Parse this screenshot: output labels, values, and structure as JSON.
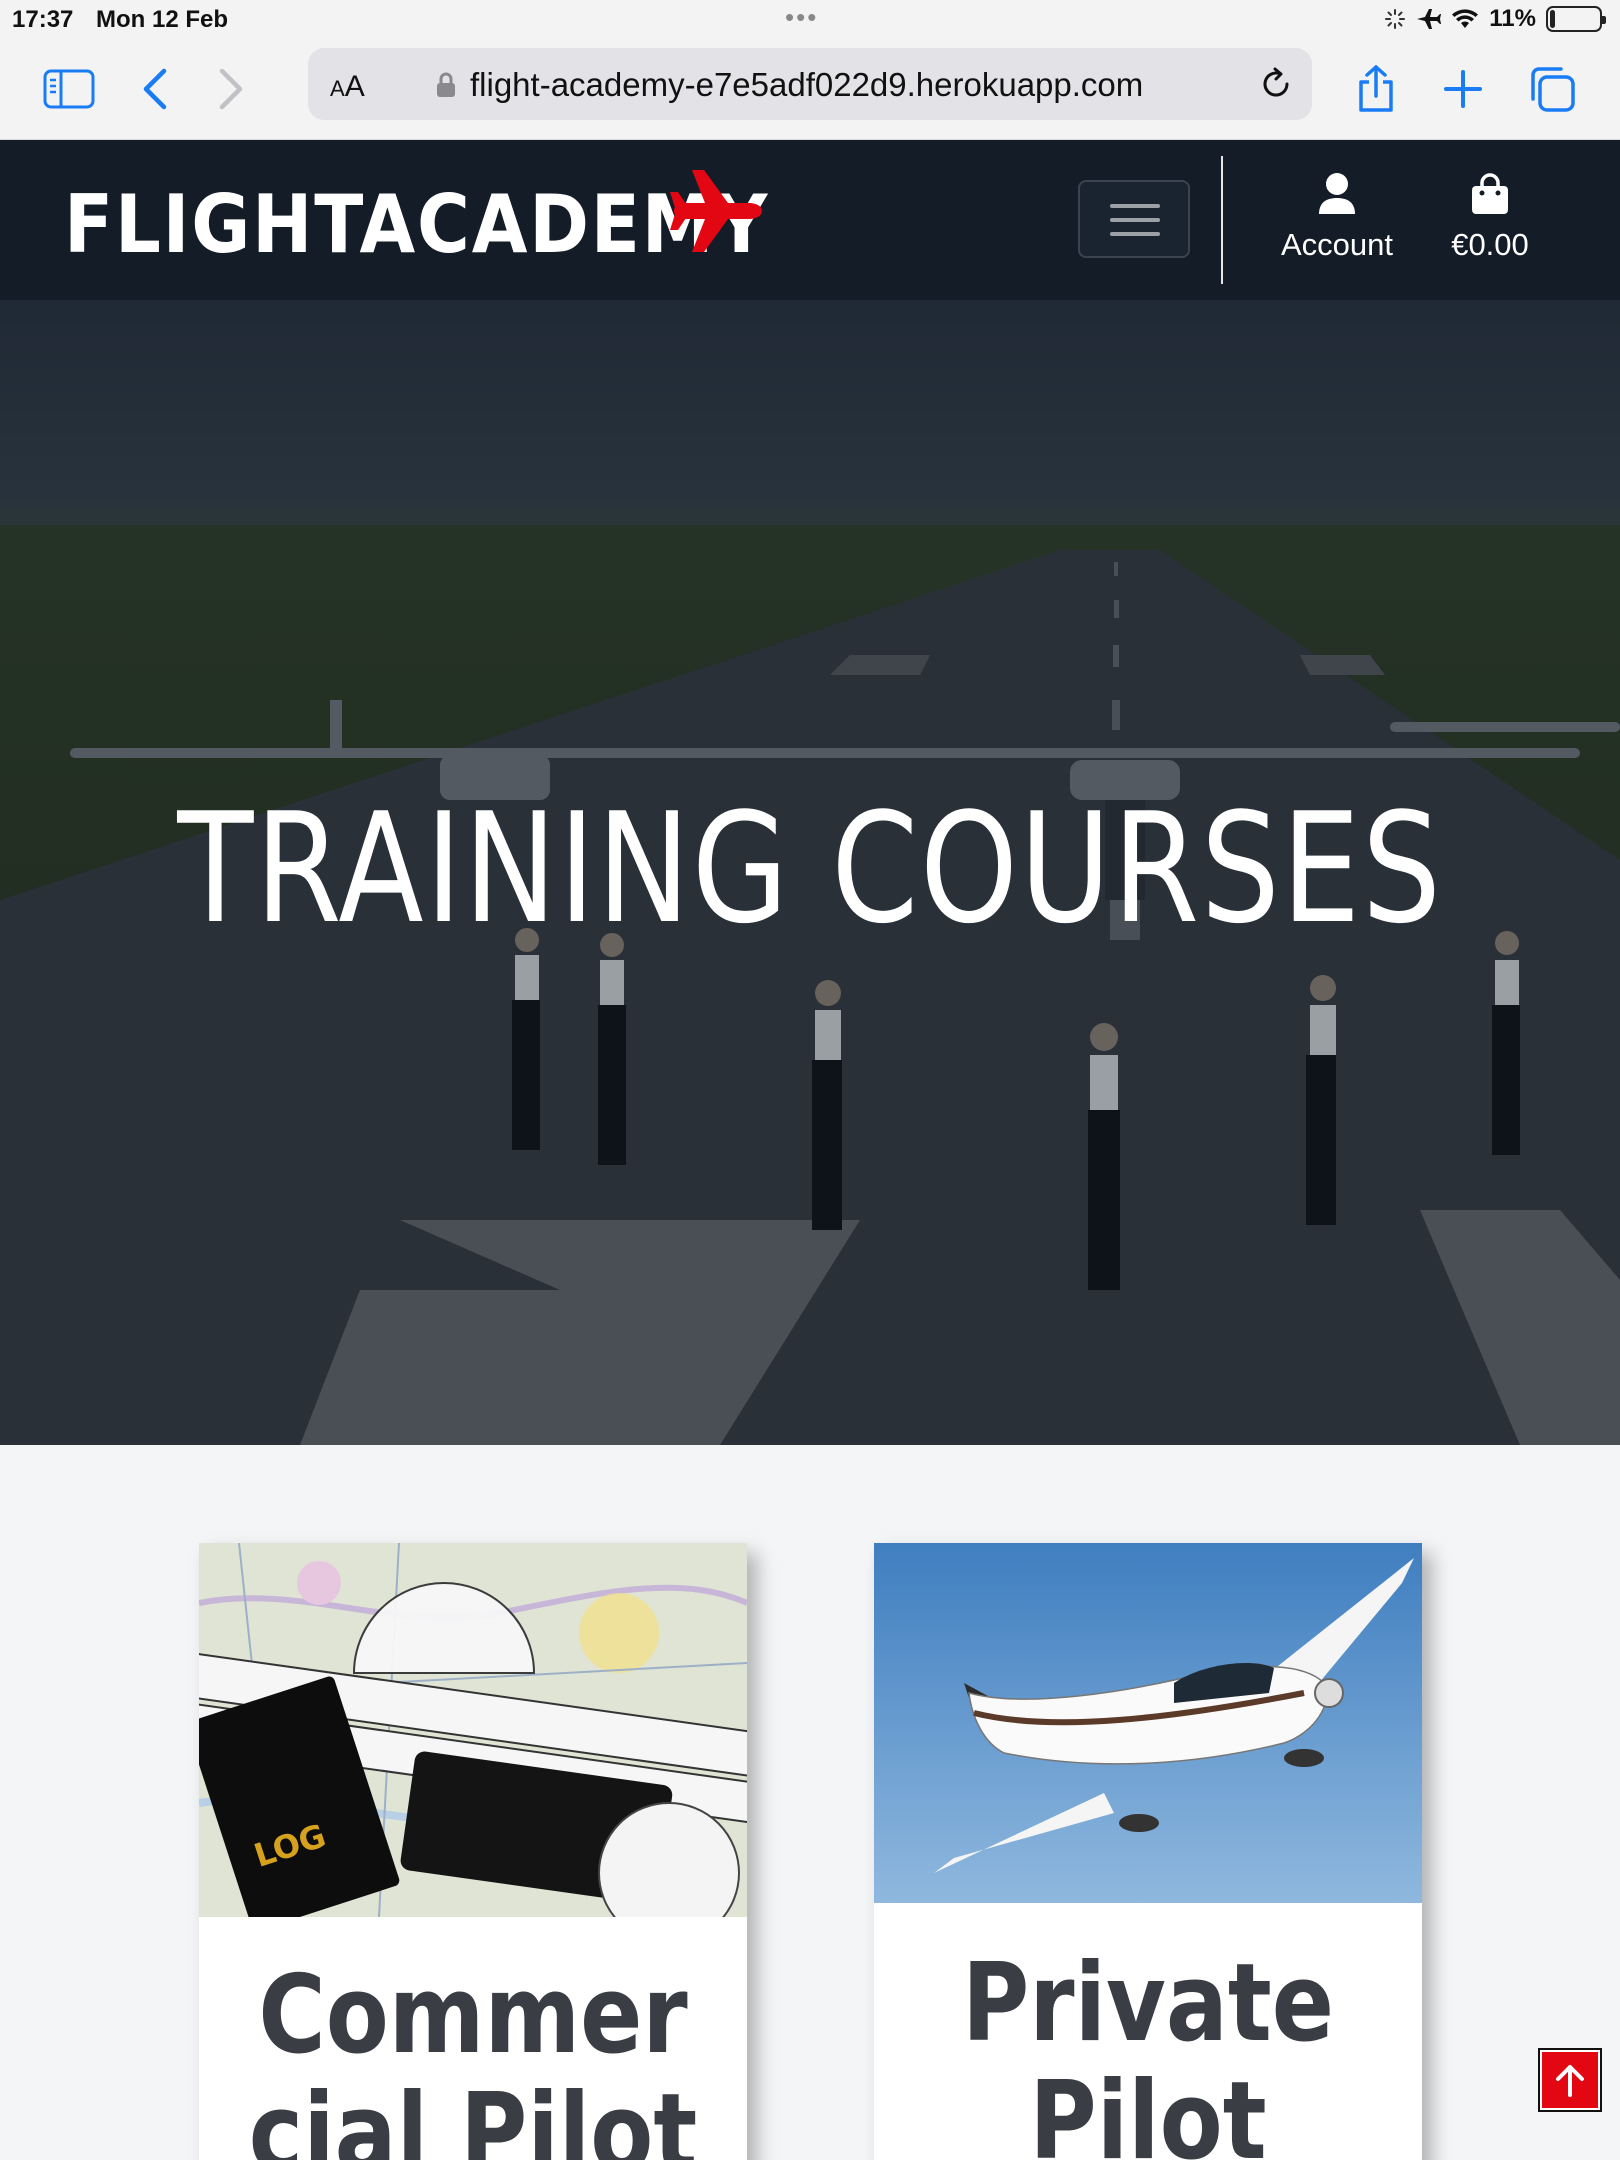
{
  "status_bar": {
    "time": "17:37",
    "date": "Mon 12 Feb",
    "battery": "11%",
    "battery_level": 0.11
  },
  "browser": {
    "text_size_label": "AA",
    "url": "flight-academy-e7e5adf022d9.herokuapp.com"
  },
  "nav": {
    "brand": "FLIGHTACADEMY",
    "account_label": "Account",
    "cart_total": "€0.00"
  },
  "hero": {
    "title": "TRAINING COURSES"
  },
  "courses": [
    {
      "title": "Commercial Pilot",
      "image_label": "LOG"
    },
    {
      "title": "Private Pilot"
    }
  ],
  "colors": {
    "nav_bg": "#131c27",
    "accent_red": "#e30613",
    "page_bg": "#f4f5f7",
    "link_blue": "#1a7cf5"
  }
}
